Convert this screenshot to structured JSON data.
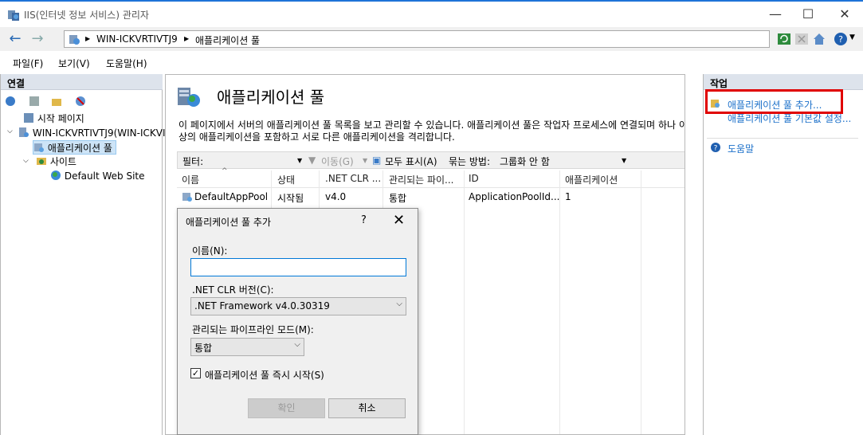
{
  "window": {
    "title": "IIS(인터넷 정보 서비스) 관리자",
    "minimize": "—",
    "maximize": "☐",
    "close": "✕"
  },
  "navbar": {
    "back": "←",
    "forward": "→",
    "breadcrumb": [
      "WIN-ICKVRTIVTJ9",
      "애플리케이션 풀"
    ],
    "separator": "▶",
    "icons": [
      "refresh-icon",
      "stop-icon",
      "home-icon",
      "help-icon"
    ]
  },
  "menu": {
    "file": "파일(F)",
    "view": "보기(V)",
    "help": "도움말(H)"
  },
  "connections": {
    "header": "연결",
    "tree": [
      {
        "label": "시작 페이지"
      },
      {
        "label": "WIN-ICKVRTIVTJ9(WIN-ICKVI"
      },
      {
        "label": "애플리케이션 풀"
      },
      {
        "label": "사이트"
      },
      {
        "label": "Default Web Site"
      }
    ]
  },
  "main": {
    "title": "애플리케이션 풀",
    "description": "이 페이지에서 서버의 애플리케이션 풀 목록을 보고 관리할 수 있습니다. 애플리케이션 풀은 작업자 프로세스에 연결되며 하나 이상의 애플리케이션을 포함하고 서로 다른 애플리케이션을 격리합니다.",
    "filter_label": "필터:",
    "go_label": "이동(G)",
    "show_all_label": "모두 표시(A)",
    "group_by_label": "묶는 방법:",
    "group_by_value": "그룹화 안 함",
    "columns": [
      "이름",
      "상태",
      ".NET CLR ...",
      "관리되는 파이...",
      "ID",
      "애플리케이션"
    ],
    "rows": [
      [
        "DefaultAppPool",
        "시작됨",
        "v4.0",
        "통합",
        "ApplicationPoolId...",
        "1"
      ]
    ]
  },
  "actions": {
    "header": "작업",
    "items": [
      "애플리케이션 풀 추가...",
      "애플리케이션 풀 기본값 설정...",
      "도움말"
    ]
  },
  "dialog": {
    "title": "애플리케이션 풀 추가",
    "help": "?",
    "close": "✕",
    "name_label": "이름(N):",
    "name_value": "",
    "clr_label": ".NET CLR 버전(C):",
    "clr_value": ".NET Framework v4.0.30319",
    "pipeline_label": "관리되는 파이프라인 모드(M):",
    "pipeline_value": "통합",
    "start_label": "애플리케이션 풀 즉시 시작(S)",
    "start_checked": true,
    "ok": "확인",
    "cancel": "취소"
  }
}
